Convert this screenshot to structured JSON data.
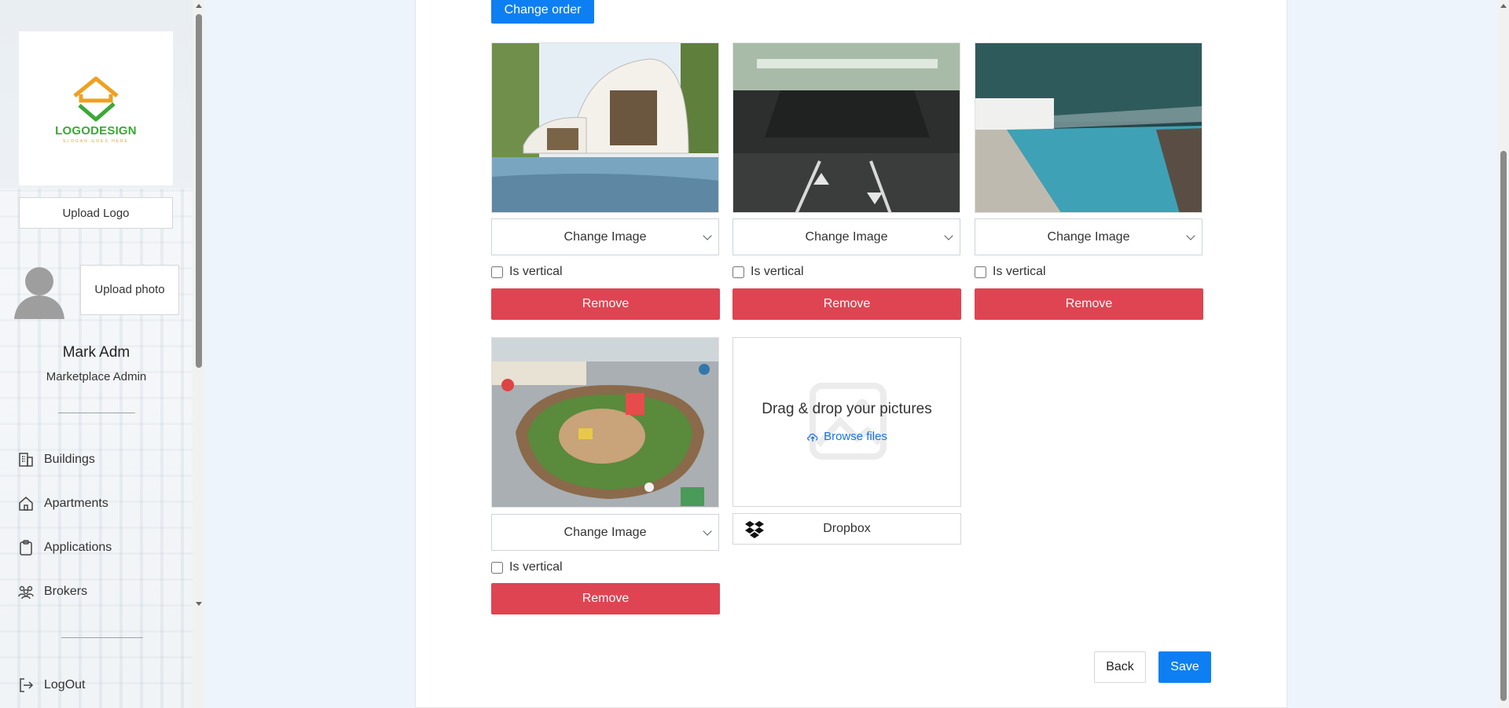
{
  "sidebar": {
    "logo": {
      "text": "LOGODESIGN",
      "subtext": "SLOGAN GOES HERE",
      "colors": {
        "house": "#f0a020",
        "check": "#3aa935"
      }
    },
    "upload_logo_label": "Upload Logo",
    "upload_photo_label": "Upload photo",
    "user": {
      "name": "Mark Adm",
      "role": "Marketplace Admin"
    },
    "nav": [
      {
        "label": "Buildings",
        "icon": "building-icon"
      },
      {
        "label": "Apartments",
        "icon": "home-icon"
      },
      {
        "label": "Applications",
        "icon": "clipboard-icon"
      },
      {
        "label": "Brokers",
        "icon": "people-icon"
      }
    ],
    "logout_label": "LogOut"
  },
  "main": {
    "change_order_label": "Change order",
    "images": [
      {
        "alt": "Modern curved villa with reflecting pool",
        "select_label": "Change Image",
        "vertical_label": "Is vertical",
        "remove_label": "Remove"
      },
      {
        "alt": "Underground parking garage",
        "select_label": "Change Image",
        "vertical_label": "Is vertical",
        "remove_label": "Remove"
      },
      {
        "alt": "Rooftop swimming pool",
        "select_label": "Change Image",
        "vertical_label": "Is vertical",
        "remove_label": "Remove"
      },
      {
        "alt": "Courtyard playground with parked cars",
        "select_label": "Change Image",
        "vertical_label": "Is vertical",
        "remove_label": "Remove"
      }
    ],
    "dropzone": {
      "title": "Drag & drop your pictures",
      "browse_label": "Browse files"
    },
    "dropbox_label": "Dropbox",
    "back_label": "Back",
    "save_label": "Save"
  },
  "colors": {
    "primary": "#0d7ff2",
    "danger": "#df4452",
    "link": "#1a73e8"
  }
}
